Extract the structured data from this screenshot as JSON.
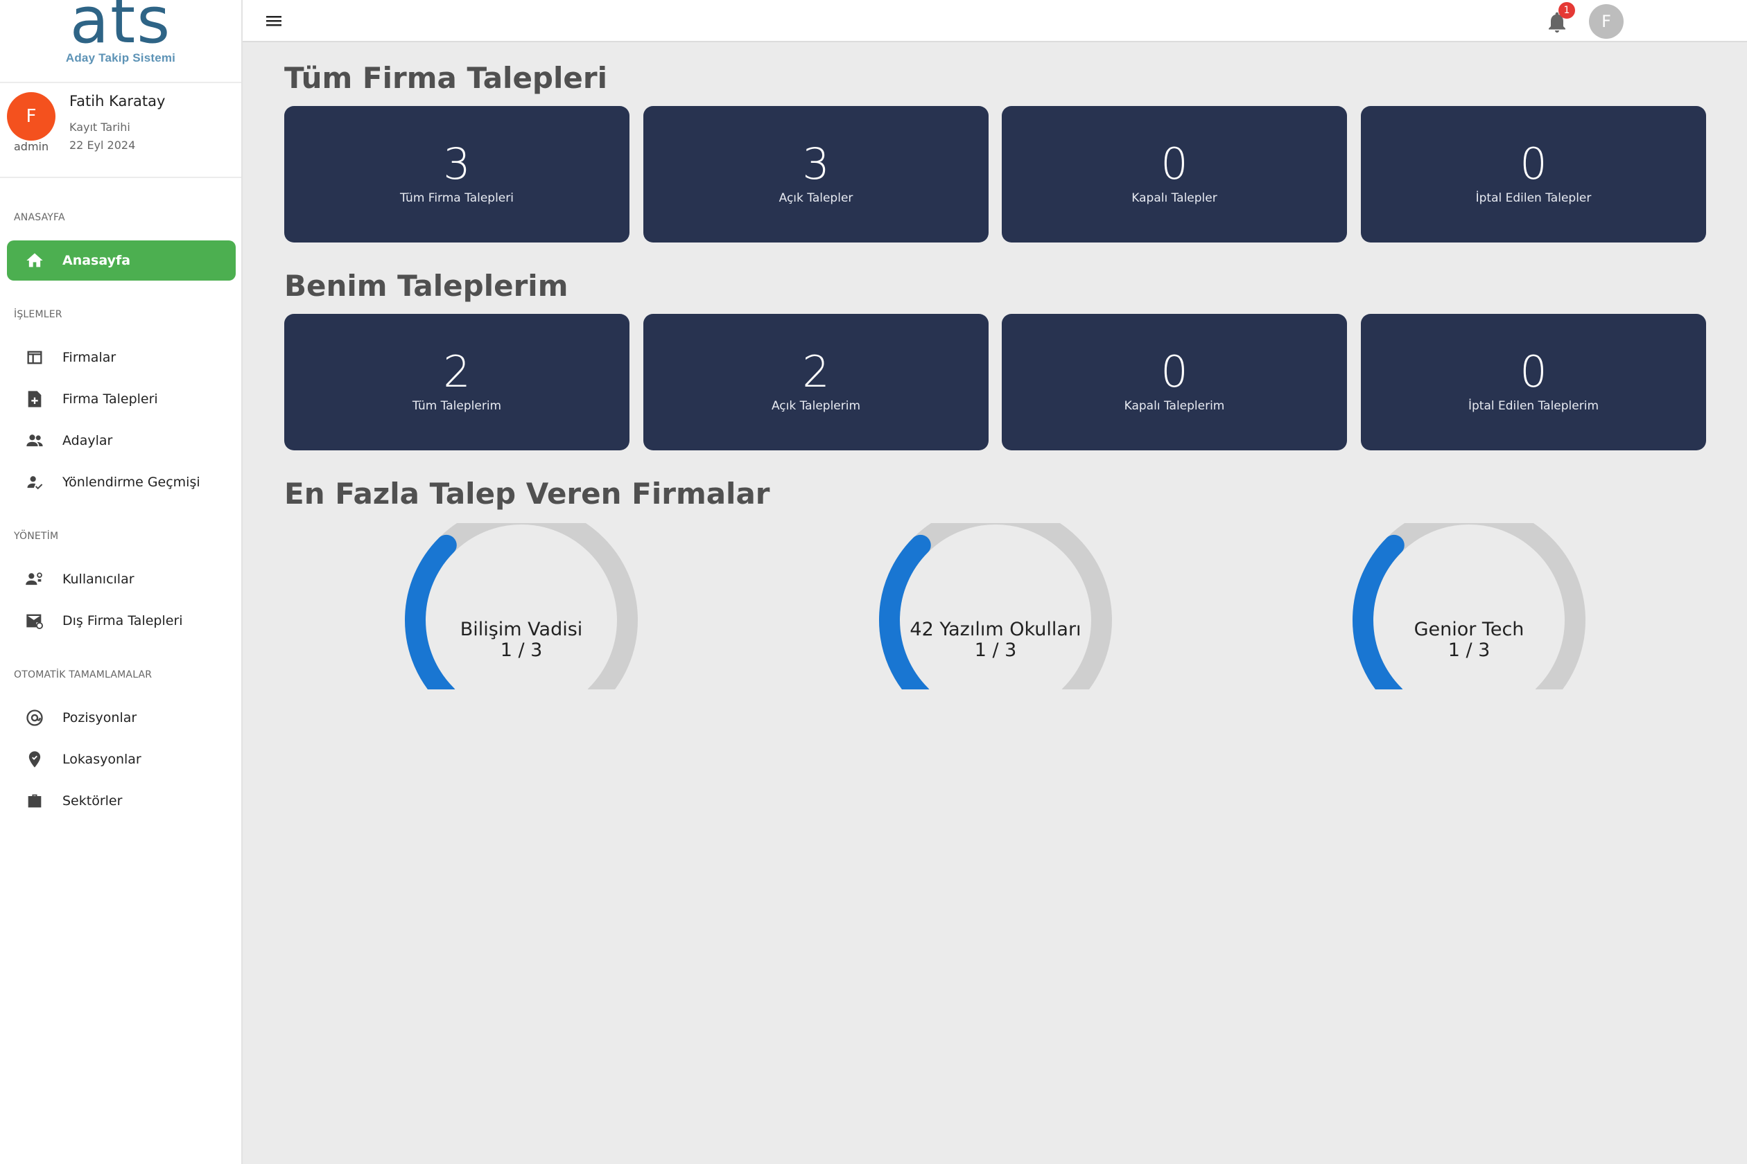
{
  "logo": {
    "mark": "ats",
    "subtitle": "Aday Takip Sistemi"
  },
  "profile": {
    "initial": "F",
    "name": "Fatih Karatay",
    "role": "admin",
    "reg_label": "Kayıt Tarihi",
    "reg_date": "22 Eyl 2024"
  },
  "sidebar": {
    "sections": [
      "ANASAYFA",
      "İŞLEMLER",
      "YÖNETİM",
      "OTOMATİK TAMAMLAMALAR"
    ],
    "items": [
      {
        "label": "Anasayfa",
        "icon": "home-icon"
      },
      {
        "label": "Firmalar",
        "icon": "table-icon"
      },
      {
        "label": "Firma Talepleri",
        "icon": "file-plus-icon"
      },
      {
        "label": "Adaylar",
        "icon": "people-icon"
      },
      {
        "label": "Yönlendirme Geçmişi",
        "icon": "person-check-icon"
      },
      {
        "label": "Kullanıcılar",
        "icon": "users-gear-icon"
      },
      {
        "label": "Dış Firma Talepleri",
        "icon": "mail-icon"
      },
      {
        "label": "Pozisyonlar",
        "icon": "at-icon"
      },
      {
        "label": "Lokasyonlar",
        "icon": "location-icon"
      },
      {
        "label": "Sektörler",
        "icon": "briefcase-icon"
      }
    ]
  },
  "topbar": {
    "notification_count": "1",
    "avatar_initial": "F"
  },
  "sections": {
    "all_requests": {
      "title": "Tüm Firma Talepleri",
      "cards": [
        {
          "value": "3",
          "label": "Tüm Firma Talepleri"
        },
        {
          "value": "3",
          "label": "Açık Talepler"
        },
        {
          "value": "0",
          "label": "Kapalı Talepler"
        },
        {
          "value": "0",
          "label": "İptal Edilen Talepler"
        }
      ]
    },
    "my_requests": {
      "title": "Benim Taleplerim",
      "cards": [
        {
          "value": "2",
          "label": "Tüm Taleplerim"
        },
        {
          "value": "2",
          "label": "Açık Taleplerim"
        },
        {
          "value": "0",
          "label": "Kapalı Taleplerim"
        },
        {
          "value": "0",
          "label": "İptal Edilen Taleplerim"
        }
      ]
    },
    "top_companies": {
      "title": "En Fazla Talep Veren Firmalar",
      "gauges": [
        {
          "name": "Bilişim Vadisi",
          "value": "1 / 3",
          "fraction": 0.3333
        },
        {
          "name": "42 Yazılım Okulları",
          "value": "1 / 3",
          "fraction": 0.3333
        },
        {
          "name": "Genior Tech",
          "value": "1 / 3",
          "fraction": 0.3333
        }
      ]
    }
  },
  "colors": {
    "accent_green": "#4caf50",
    "card_bg": "#283350",
    "gauge_fill": "#1976d2",
    "gauge_track": "#cfcfcf",
    "badge": "#e53935"
  }
}
